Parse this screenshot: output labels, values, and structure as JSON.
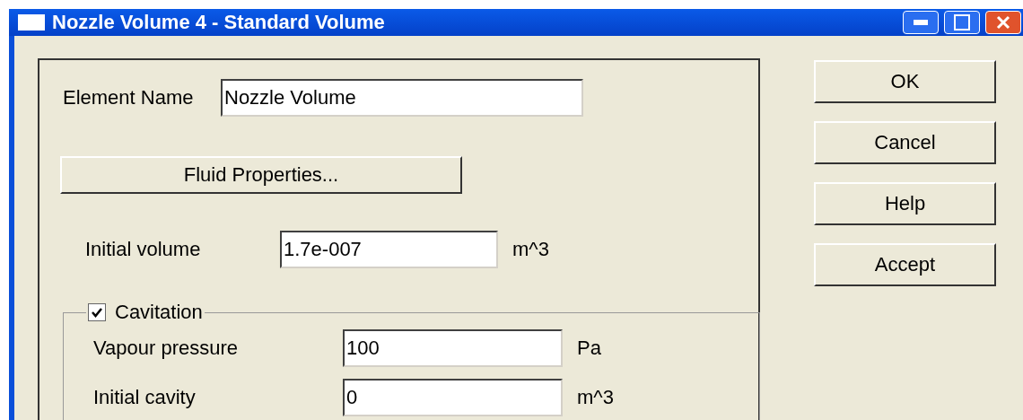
{
  "window": {
    "title": "Nozzle Volume 4 - Standard Volume"
  },
  "element_name": {
    "label": "Element Name",
    "value": "Nozzle Volume"
  },
  "fluid_button": "Fluid Properties...",
  "initial_volume": {
    "label": "Initial volume",
    "value": "1.7e-007",
    "unit": "m^3"
  },
  "cavitation": {
    "label": "Cavitation",
    "checked": true,
    "fields": [
      {
        "label": "Vapour pressure",
        "value": "100",
        "unit": "Pa"
      },
      {
        "label": "Initial cavity",
        "value": "0",
        "unit": "m^3"
      }
    ]
  },
  "buttons": [
    "OK",
    "Cancel",
    "Help",
    "Accept"
  ]
}
